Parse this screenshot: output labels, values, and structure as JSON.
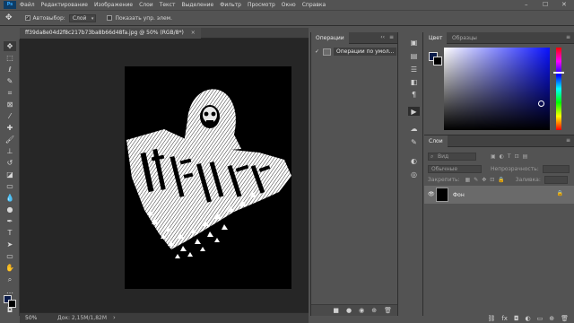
{
  "menubar": {
    "logo": "Ps",
    "items": [
      "Файл",
      "Редактирование",
      "Изображение",
      "Слои",
      "Текст",
      "Выделение",
      "Фильтр",
      "Просмотр",
      "Окно",
      "Справка"
    ],
    "win_minimize": "–",
    "win_maximize": "☐",
    "win_close": "✕"
  },
  "options_bar": {
    "autoselect_label": "Автовыбор:",
    "autoselect_value": "Слой",
    "show_controls_label": "Показать упр. элем."
  },
  "document": {
    "tab_title": "ff39da8e04d2f8c217b73ba8b66d48fa.jpg @ 50% (RGB/8*)",
    "tab_close": "×",
    "zoom": "50%",
    "doc_info": "Док: 2,15M/1,82M",
    "status_arrow": "›"
  },
  "history_panel": {
    "title": "Операции",
    "collapse": "‹‹",
    "menu": "≡",
    "item": "Операции по умол..."
  },
  "color_panel": {
    "tabs": [
      "Цвет",
      "Образцы"
    ],
    "fg_color": "#0c1c4a",
    "bg_color": "#000000"
  },
  "layers_panel": {
    "title": "Слои",
    "filter_placeholder": "Вид",
    "blend_mode": "Обычные",
    "opacity_label": "Непрозрачность:",
    "lock_label": "Закрепить:",
    "fill_label": "Заливка:",
    "layer_name": "Фон"
  }
}
